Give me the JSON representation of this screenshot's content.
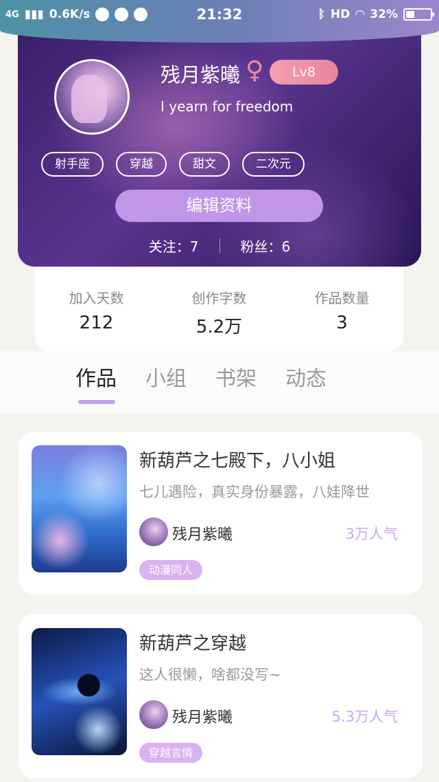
{
  "status_bar": {
    "network": "4G",
    "speed": "0.6K/s",
    "time": "21:32",
    "hd": "HD",
    "battery_text": "32%",
    "battery_level": 0.32
  },
  "profile": {
    "username": "残月紫曦",
    "gender_symbol": "♀",
    "level": "Lv8",
    "signature": "I yearn for freedom",
    "tags": [
      "射手座",
      "穿越",
      "甜文",
      "二次元"
    ],
    "edit_label": "编辑资料",
    "following": "关注：7",
    "followers": "粉丝：6"
  },
  "stats": [
    {
      "label": "加入天数",
      "value": "212"
    },
    {
      "label": "创作字数",
      "value": "5.2万"
    },
    {
      "label": "作品数量",
      "value": "3"
    }
  ],
  "tabs": [
    {
      "label": "作品",
      "active": true
    },
    {
      "label": "小组",
      "active": false
    },
    {
      "label": "书架",
      "active": false
    },
    {
      "label": "动态",
      "active": false
    }
  ],
  "works": [
    {
      "title": "新葫芦之七殿下，八小姐",
      "description": "七儿遇险，真实身份暴露，八娃降世",
      "author": "残月紫曦",
      "popularity": "3万人气",
      "category": "动漫同人"
    },
    {
      "title": "新葫芦之穿越",
      "description": "这人很懒，啥都没写~",
      "author": "残月紫曦",
      "popularity": "5.3万人气",
      "category": "穿越言情"
    }
  ]
}
